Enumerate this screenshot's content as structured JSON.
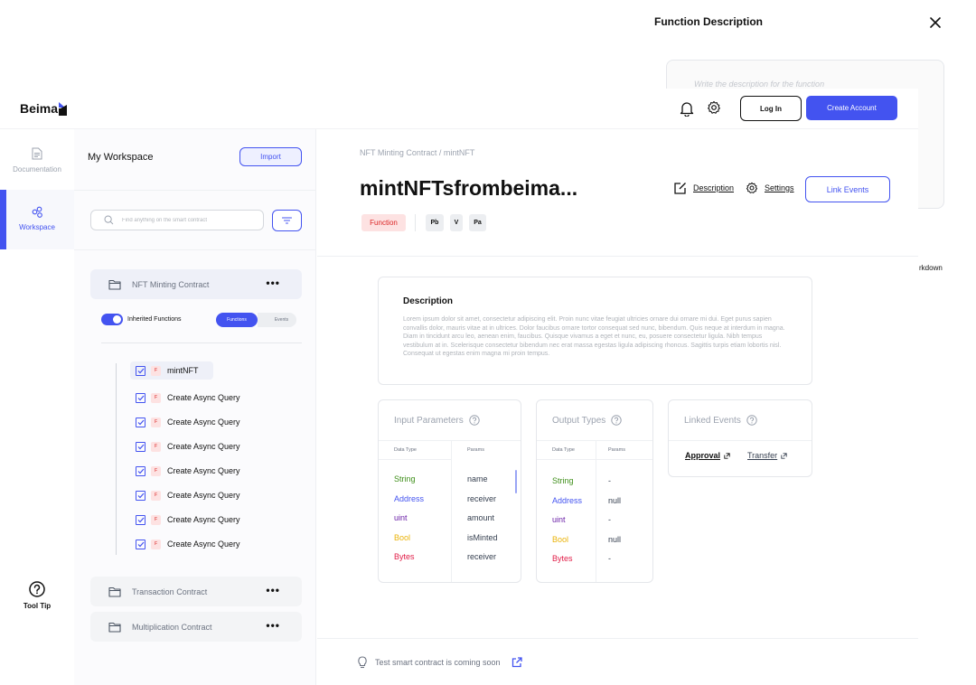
{
  "drawer": {
    "title": "Function Description",
    "textarea_placeholder": "Write the description for the function",
    "markdown_hint": "rkdown"
  },
  "header": {
    "logo_text": "Beima",
    "login_label": "Log In",
    "create_account_label": "Create Account"
  },
  "rail": {
    "documentation_label": "Documentation",
    "workspace_label": "Workspace",
    "tooltip_label": "Tool Tip"
  },
  "workspace": {
    "title": "My Workspace",
    "import_label": "Import",
    "search_placeholder": "Find anything on the smart contract",
    "contracts": [
      {
        "name": "NFT Minting Contract"
      },
      {
        "name": "Transaction Contract"
      },
      {
        "name": "Multiplication Contract"
      }
    ],
    "inherited_label": "Inherited Functions",
    "functions_tab": "Functions",
    "events_tab": "Events",
    "functions": [
      {
        "badge": "F",
        "name": "mintNFT"
      },
      {
        "badge": "F",
        "name": "Create Async Query"
      },
      {
        "badge": "F",
        "name": "Create Async Query"
      },
      {
        "badge": "F",
        "name": "Create Async Query"
      },
      {
        "badge": "F",
        "name": "Create Async Query"
      },
      {
        "badge": "F",
        "name": "Create Async Query"
      },
      {
        "badge": "F",
        "name": "Create Async Query"
      },
      {
        "badge": "F",
        "name": "Create Async Query"
      }
    ]
  },
  "main": {
    "breadcrumb": "NFT Minting Contract / mintNFT",
    "title": "mintNFTsfrombeima...",
    "description_action": "Description",
    "settings_action": "Settings",
    "link_events_label": "Link Events",
    "tags": {
      "type": "Function",
      "pb": "Pb",
      "v": "V",
      "pa": "Pa"
    },
    "description": {
      "heading": "Description",
      "body": "Lorem ipsum dolor sit amet, consectetur adipiscing elit. Proin nunc vitae feugiat ultricies ornare dui ornare mi dui. Eget purus sapien convallis dolor, mauris vitae at in ultrices. Dolor faucibus ornare tortor consequat sed nunc, bibendum. Quis neque at interdum in magna. Diam in tincidunt arcu leo, aenean enim, faucibus. Quisque vivamus a eget et nunc, eu, posuere consectetur ligula. Nibh tempus vestibulum at in. Scelerisque consectetur bibendum nec erat massa egestas ligula adipiscing rhoncus. Sagittis turpis etiam lobortis nisl. Consequat ut egestas enim magna mi proin tempus."
    },
    "input_parameters": {
      "title": "Input Parameters",
      "col_type": "Data Type",
      "col_params": "Params",
      "rows": [
        {
          "type": "String",
          "param": "name",
          "color": "#3f8f1a"
        },
        {
          "type": "Address",
          "param": "receiver",
          "color": "#4353f0"
        },
        {
          "type": "uint",
          "param": "amount",
          "color": "#6b21a8"
        },
        {
          "type": "Bool",
          "param": "isMinted",
          "color": "#eab308"
        },
        {
          "type": "Bytes",
          "param": "receiver",
          "color": "#e11d48"
        }
      ]
    },
    "output_types": {
      "title": "Output Types",
      "col_type": "Data Type",
      "col_params": "Params",
      "rows": [
        {
          "type": "String",
          "param": "-",
          "color": "#3f8f1a"
        },
        {
          "type": "Address",
          "param": "null",
          "color": "#4353f0"
        },
        {
          "type": "uint",
          "param": "-",
          "color": "#6b21a8"
        },
        {
          "type": "Bool",
          "param": "null",
          "color": "#eab308"
        },
        {
          "type": "Bytes",
          "param": "-",
          "color": "#e11d48"
        }
      ]
    },
    "linked_events": {
      "title": "Linked Events",
      "events": [
        "Approval",
        "Transfer"
      ]
    },
    "footer_note": "Test smart contract is coming soon"
  },
  "colors": {
    "accent": "#4353f0",
    "function_tag_bg": "#fde2e2",
    "function_tag_text": "#dc2626"
  }
}
